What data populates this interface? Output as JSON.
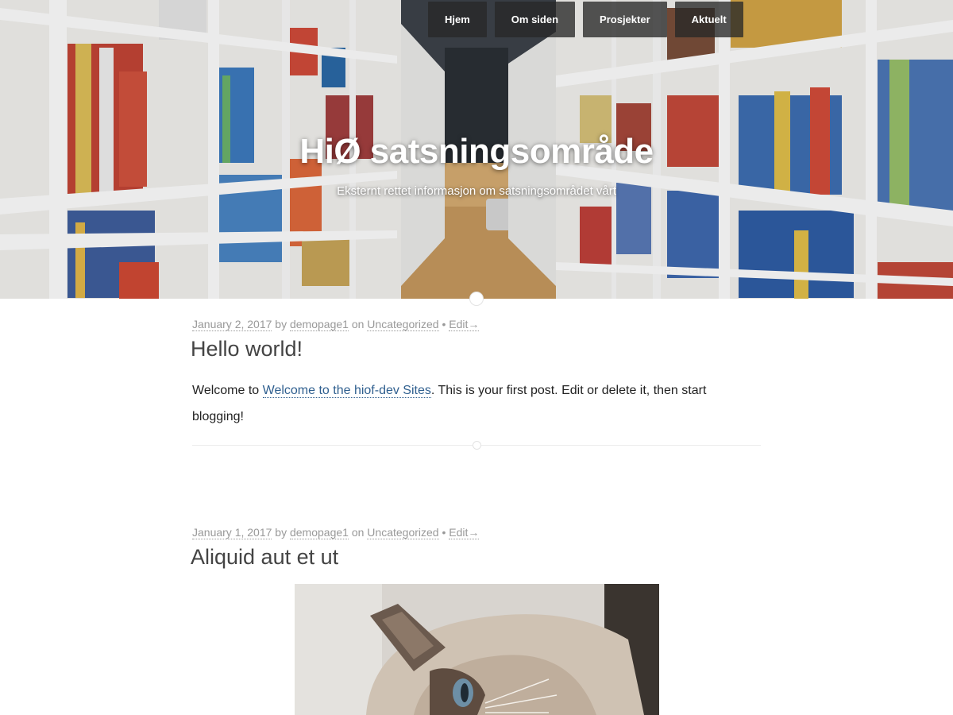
{
  "header": {
    "title": "HiØ satsningsområde",
    "description": "Eksternt rettet informasjon om satsningsområdet vårt",
    "nav": [
      {
        "label": "Hjem"
      },
      {
        "label": "Om siden"
      },
      {
        "label": "Prosjekter"
      },
      {
        "label": "Aktuelt"
      }
    ]
  },
  "posts": [
    {
      "date": "January 2, 2017",
      "by": "by",
      "author": "demopage1",
      "on": "on",
      "category": "Uncategorized",
      "edit": "Edit→",
      "title": "Hello world!",
      "body_prefix": "Welcome to ",
      "body_link": "Welcome to the hiof-dev Sites",
      "body_suffix": ". This is your first post. Edit or delete it, then start blogging!"
    },
    {
      "date": "January 1, 2017",
      "by": "by",
      "author": "demopage1",
      "on": "on",
      "category": "Uncategorized",
      "edit": "Edit→",
      "title": "Aliquid aut et ut"
    }
  ],
  "colors": {
    "nav_bg": "#282828",
    "link": "#2f5f8f",
    "meta": "#999999"
  }
}
